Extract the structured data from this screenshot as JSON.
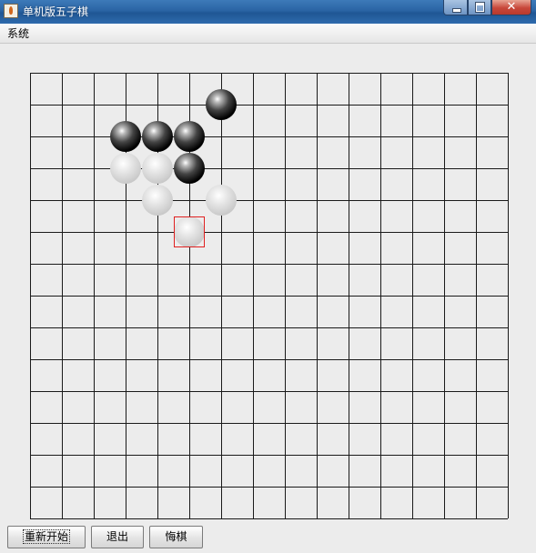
{
  "window": {
    "title": "单机版五子棋",
    "icon": "java-cup-icon"
  },
  "title_buttons": {
    "close_label": "✕"
  },
  "menu": {
    "items": [
      {
        "label": "系统"
      }
    ]
  },
  "board": {
    "columns": 16,
    "rows": 15,
    "stones": [
      {
        "col": 6,
        "row": 1,
        "color": "black"
      },
      {
        "col": 3,
        "row": 2,
        "color": "black"
      },
      {
        "col": 4,
        "row": 2,
        "color": "black"
      },
      {
        "col": 5,
        "row": 2,
        "color": "black"
      },
      {
        "col": 3,
        "row": 3,
        "color": "white"
      },
      {
        "col": 4,
        "row": 3,
        "color": "white"
      },
      {
        "col": 5,
        "row": 3,
        "color": "black"
      },
      {
        "col": 4,
        "row": 4,
        "color": "white"
      },
      {
        "col": 6,
        "row": 4,
        "color": "white"
      },
      {
        "col": 5,
        "row": 5,
        "color": "white"
      }
    ],
    "last_move": {
      "col": 5,
      "row": 5
    },
    "colors": {
      "line": "#1a1a1a",
      "marker": "#e02020"
    }
  },
  "buttons": {
    "restart_label": "重新开始",
    "exit_label": "退出",
    "undo_label": "悔棋"
  }
}
